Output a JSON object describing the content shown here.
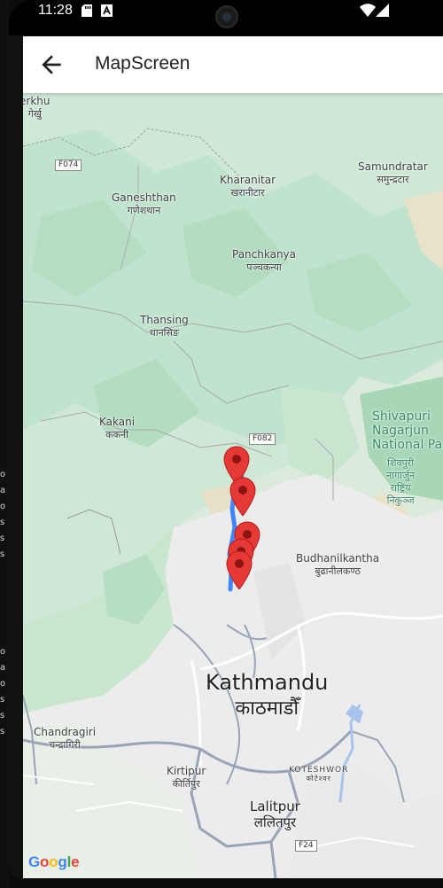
{
  "status_bar": {
    "time": "11:28",
    "icons": [
      "sd-card-icon",
      "notification-a-icon",
      "wifi-icon",
      "signal-icon"
    ]
  },
  "app_bar": {
    "title": "MapScreen",
    "back_icon": "arrow-back-icon"
  },
  "map": {
    "labels": [
      {
        "key": "erkhu",
        "en": "erkhu",
        "dev": "गेर्खु"
      },
      {
        "key": "kharanitar",
        "en": "Kharanitar",
        "dev": "खरानीटार"
      },
      {
        "key": "samundratar",
        "en": "Samundratar",
        "dev": "समुन्द्रटार"
      },
      {
        "key": "ganeshthan",
        "en": "Ganeshthan",
        "dev": "गणेशथान"
      },
      {
        "key": "panchkanya",
        "en": "Panchkanya",
        "dev": "पञ्चकन्या"
      },
      {
        "key": "thansing",
        "en": "Thansing",
        "dev": "थानसिङ"
      },
      {
        "key": "kakani",
        "en": "Kakani",
        "dev": "ककनी"
      },
      {
        "key": "budhanilkantha",
        "en": "Budhanilkantha",
        "dev": "बुढानीलकण्ठ"
      },
      {
        "key": "chandragiri",
        "en": "Chandragiri",
        "dev": "चन्द्रागिरी"
      },
      {
        "key": "kirtipur",
        "en": "Kirtipur",
        "dev": "कीर्तिपुर"
      },
      {
        "key": "koteshwor",
        "en": "KOTESHWOR",
        "dev": "कोटेश्वर"
      },
      {
        "key": "lalitpur",
        "en": "Lalitpur",
        "dev": "ललितपुर"
      }
    ],
    "park": {
      "lines": [
        "Shivapuri",
        "Nagarjun",
        "National Pa"
      ],
      "dev_lines": [
        "शिवपुरी",
        "नागार्जुन",
        "राष्ट्रिय",
        "निकुञ्ज"
      ]
    },
    "city": {
      "en": "Kathmandu",
      "dev": "काठमाडौँ"
    },
    "road_shields": [
      "F074",
      "F082",
      "F24"
    ],
    "attribution": "Google",
    "marker_count": 5,
    "colors": {
      "marker": "#e53935",
      "route": "#4285f4",
      "forest": "#bfe3cc",
      "urban": "#efefef",
      "road": "#9aa3b8"
    }
  },
  "edge_fragments": [
    "o",
    "a",
    "o",
    "s",
    "s",
    "s",
    "o",
    "a",
    "o",
    "s",
    "s",
    "s"
  ]
}
